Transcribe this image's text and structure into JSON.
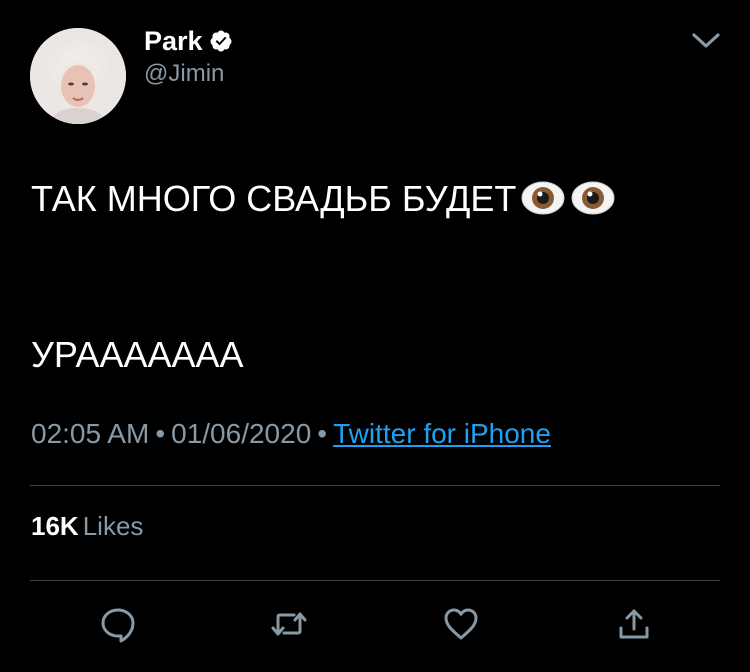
{
  "author": {
    "display_name": "Park",
    "handle": "@Jimin",
    "verified": true,
    "avatar": "profile-photo"
  },
  "tweet": {
    "lines": [
      "ТАК МНОГО СВАДЬБ БУДЕТ",
      "УРААААААА"
    ],
    "emoji": [
      "eyes",
      "eyes"
    ]
  },
  "meta": {
    "time": "02:05 AM",
    "date": "01/06/2020",
    "separator": "•",
    "source": "Twitter for iPhone"
  },
  "stats": {
    "likes_count": "16K",
    "likes_label": "Likes"
  },
  "actions": [
    {
      "icon": "reply-icon"
    },
    {
      "icon": "retweet-icon"
    },
    {
      "icon": "like-icon"
    },
    {
      "icon": "share-icon"
    }
  ],
  "colors": {
    "background": "#000000",
    "text": "#ffffff",
    "secondary": "#8899a6",
    "link": "#1da1f2",
    "divider": "#38444d"
  }
}
